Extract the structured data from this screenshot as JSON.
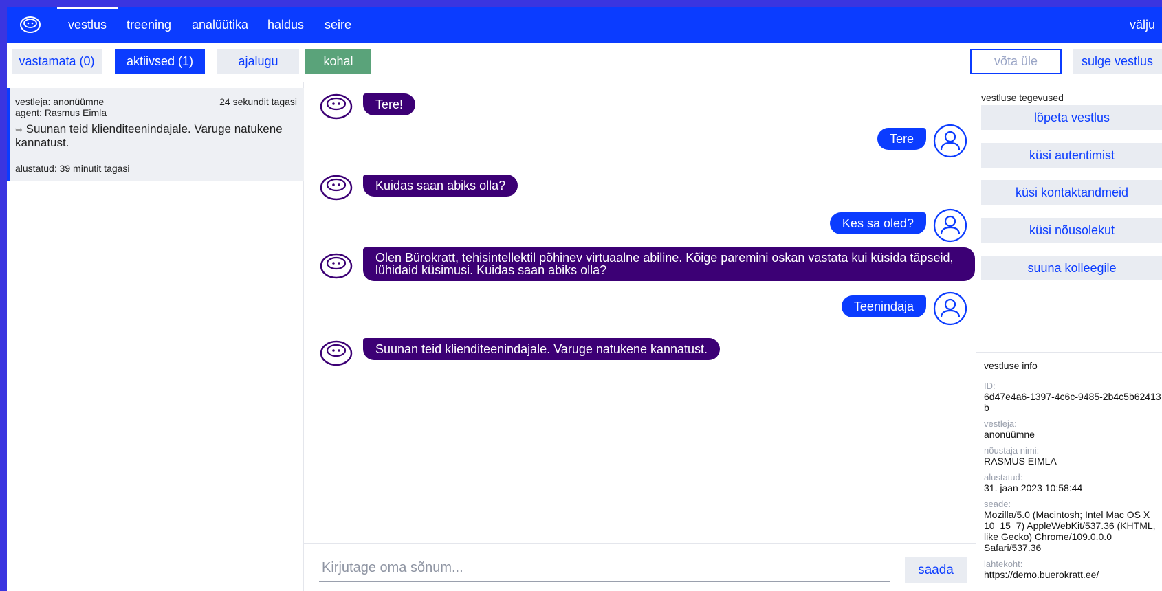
{
  "nav": {
    "items": [
      "vestlus",
      "treening",
      "analüütika",
      "haldus",
      "seire"
    ],
    "active": "vestlus",
    "exit": "välju"
  },
  "toolbar": {
    "unanswered": "vastamata (0)",
    "active": "aktiivsed (1)",
    "history": "ajalugu",
    "present": "kohal",
    "takeover": "võta üle",
    "close": "sulge vestlus"
  },
  "chat_list": [
    {
      "client": "vestleja: anonüümne",
      "agent": "agent: Rasmus Eimla",
      "time": "24 sekundit tagasi",
      "last_message": "Suunan teid klienditeenindajale. Varuge natukene kannatust.",
      "started": "alustatud: 39 minutit tagasi"
    }
  ],
  "messages": [
    {
      "from": "bot",
      "text": "Tere!"
    },
    {
      "from": "user",
      "text": "Tere"
    },
    {
      "from": "bot",
      "text": "Kuidas saan abiks olla?"
    },
    {
      "from": "user",
      "text": "Kes sa oled?"
    },
    {
      "from": "bot",
      "text": "Olen Bürokratt, tehisintellektil põhinev virtuaalne abiline. Kõige paremini oskan vastata kui küsida täpseid, lühidaid küsimusi. Kuidas saan abiks olla?"
    },
    {
      "from": "user",
      "text": "Teenindaja"
    },
    {
      "from": "bot",
      "text": "Suunan teid klienditeenindajale. Varuge natukene kannatust."
    }
  ],
  "composer": {
    "placeholder": "Kirjutage oma sõnum...",
    "send": "saada"
  },
  "actions": {
    "title": "vestluse tegevused",
    "end": "lõpeta vestlus",
    "auth": "küsi autentimist",
    "contact": "küsi kontaktandmeid",
    "consent": "küsi nõusolekut",
    "forward": "suuna kolleegile"
  },
  "info": {
    "title": "vestluse info",
    "id_label": "ID:",
    "id": "6d47e4a6-1397-4c6c-9485-2b4c5b62413b",
    "client_label": "vestleja:",
    "client": "anonüümne",
    "advisor_label": "nõustaja nimi:",
    "advisor": "RASMUS EIMLA",
    "started_label": "alustatud:",
    "started": "31. jaan 2023 10:58:44",
    "device_label": "seade:",
    "device": "Mozilla/5.0 (Macintosh; Intel Mac OS X 10_15_7) AppleWebKit/537.36 (KHTML, like Gecko) Chrome/109.0.0.0 Safari/537.36",
    "source_label": "lähtekoht:",
    "source": "https://demo.buerokratt.ee/"
  },
  "colors": {
    "primary": "#0b3cff",
    "bot_bubble": "#3c0075",
    "present": "#5aa37a",
    "frame": "#3b35e0"
  }
}
